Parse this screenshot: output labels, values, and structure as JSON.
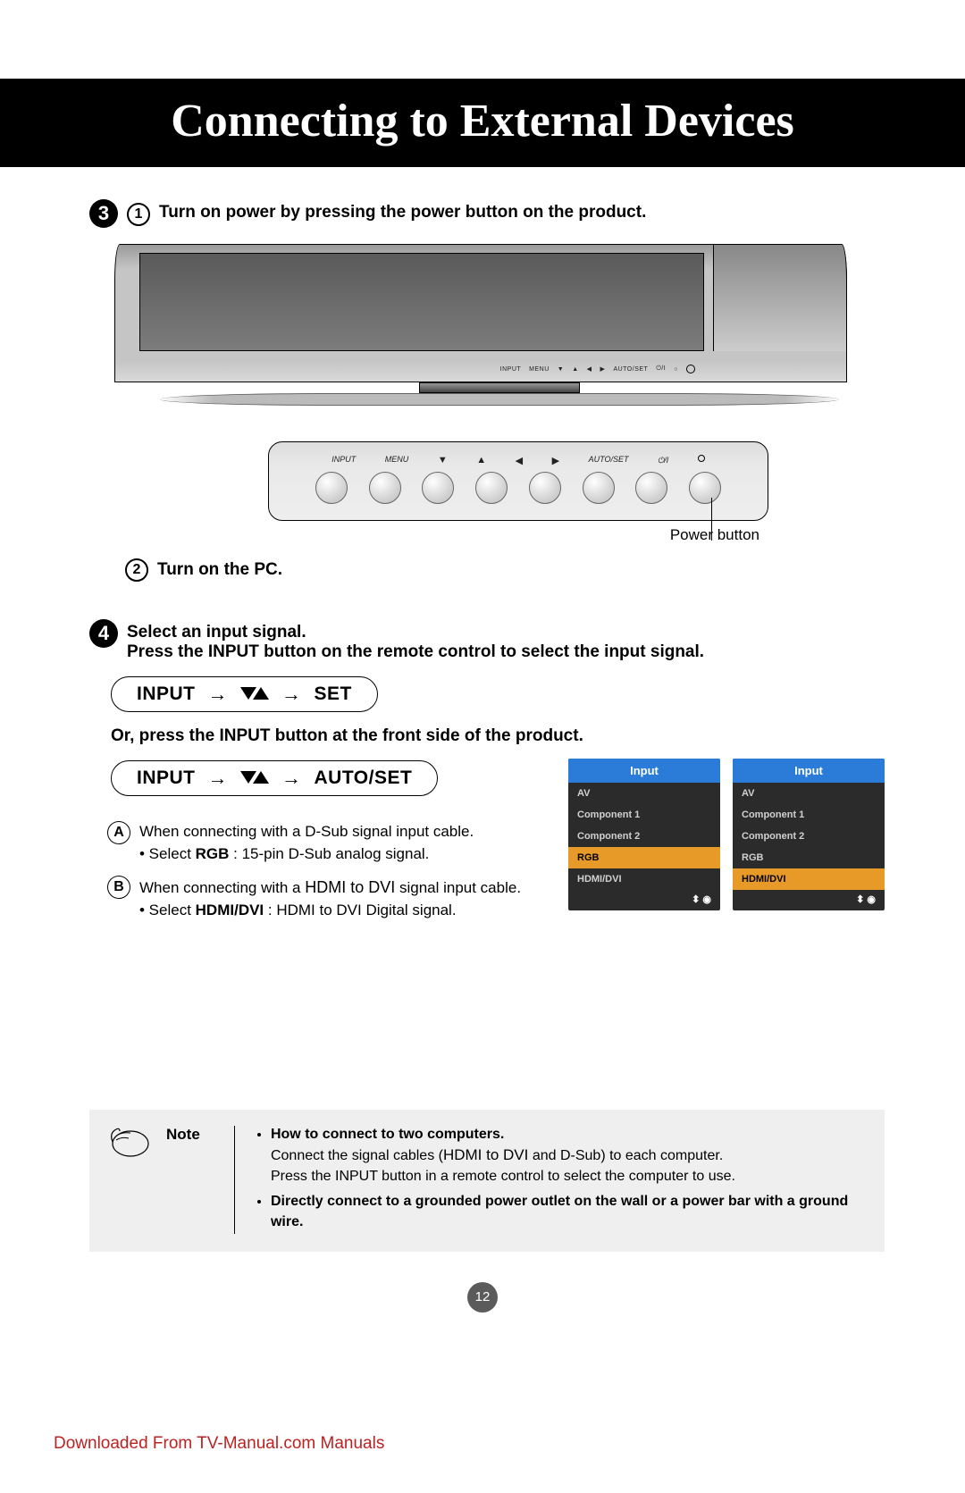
{
  "header": {
    "title": "Connecting to External Devices"
  },
  "step3": {
    "num": "3",
    "sub1_num": "1",
    "sub1_text": "Turn on power by pressing the power button on the product.",
    "monitor_btn_strip": [
      "INPUT",
      "MENU",
      "▼",
      "▲",
      "◀",
      "▶",
      "AUTO/SET",
      "⏻/I",
      "○"
    ],
    "panel_labels": {
      "input": "INPUT",
      "menu": "MENU",
      "autoset": "AUTO/SET",
      "power": "⏻/I"
    },
    "panel_arrows": [
      "▼",
      "▲",
      "◀",
      "▶"
    ],
    "panel_caption": "Power button",
    "sub2_num": "2",
    "sub2_text": "Turn on the PC."
  },
  "step4": {
    "num": "4",
    "line1": "Select an input signal.",
    "line2": "Press the INPUT button on the remote control to select the input signal.",
    "pill1": {
      "l": "INPUT",
      "r": "SET"
    },
    "line3": "Or, press the INPUT button at the front side of the product.",
    "pill2": {
      "l": "INPUT",
      "r": "AUTO/SET"
    },
    "optA": {
      "letter": "A",
      "t1": "When connecting with a D-Sub signal input cable.",
      "t2_pre": "• Select ",
      "t2_b": "RGB",
      "t2_post": " : 15-pin D-Sub analog signal."
    },
    "optB": {
      "letter": "B",
      "t1_pre": "When connecting with a ",
      "t1_mid": "HDMI to DVI",
      "t1_post": " signal input cable.",
      "t2_pre": "• Select ",
      "t2_b": "HDMI/DVI",
      "t2_post": " : HDMI to DVI Digital signal."
    }
  },
  "osd": {
    "head": "Input",
    "items": [
      "AV",
      "Component 1",
      "Component 2",
      "RGB",
      "HDMI/DVI"
    ],
    "foot": "⬍ ◉",
    "sel_left_idx": 3,
    "sel_right_idx": 4
  },
  "note": {
    "label": "Note",
    "b1_head": "How to connect to two computers.",
    "b1_l1_pre": "Connect the signal cables (",
    "b1_l1_mid": "HDMI to DVI",
    "b1_l1_post": " and D-Sub) to each computer.",
    "b1_l2": "Press the INPUT button in a remote control to select the computer to use.",
    "b2": "Directly connect to a grounded power outlet on the wall or a power bar with a ground wire."
  },
  "page_num": "12",
  "download": "Downloaded From TV-Manual.com Manuals"
}
